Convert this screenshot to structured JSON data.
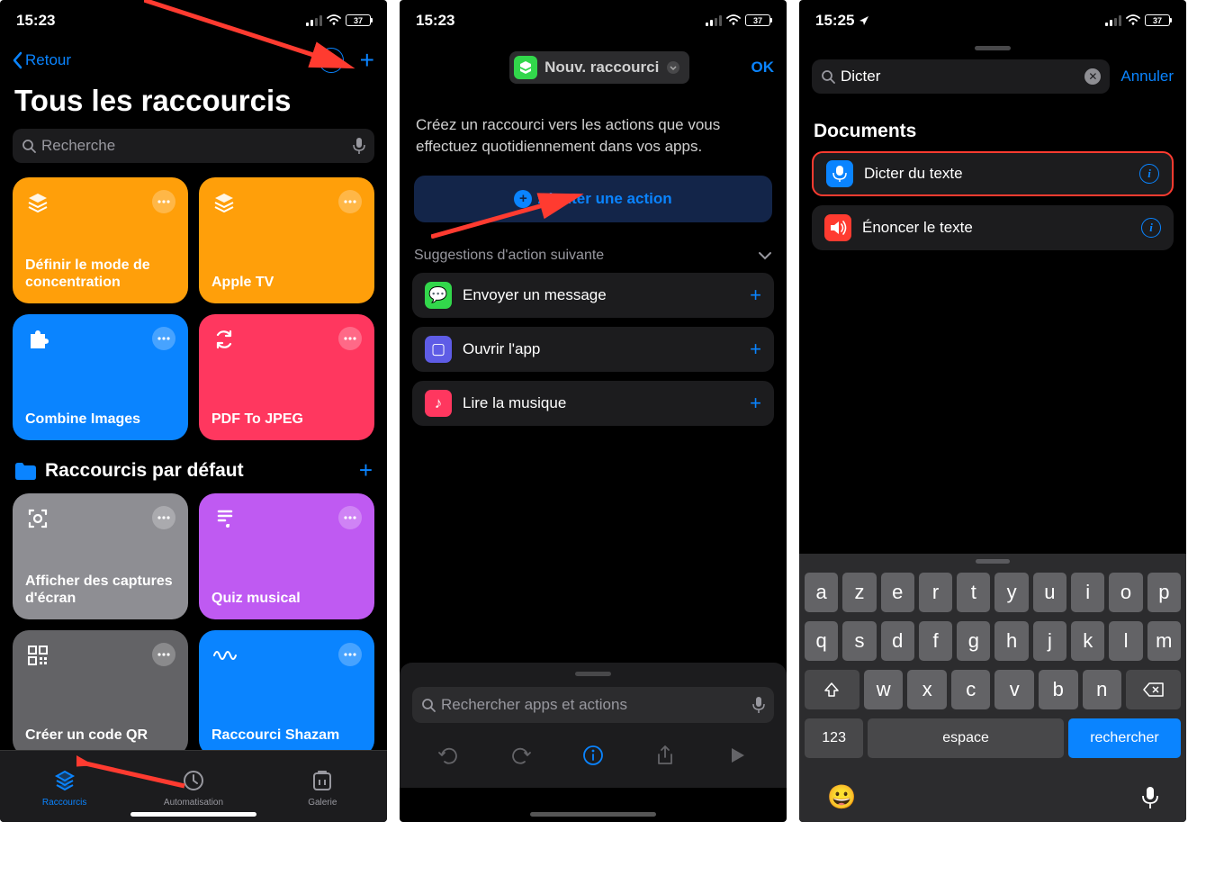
{
  "screen1": {
    "time": "15:23",
    "battery": "37",
    "back": "Retour",
    "title": "Tous les raccourcis",
    "search_placeholder": "Recherche",
    "tiles": [
      {
        "label": "Définir le mode de concentration",
        "color": "#ff9f0a",
        "icon": "layers"
      },
      {
        "label": "Apple TV",
        "color": "#ff9f0a",
        "icon": "layers"
      },
      {
        "label": "Combine Images",
        "color": "#0a84ff",
        "icon": "puzzle"
      },
      {
        "label": "PDF To JPEG",
        "color": "#ff375f",
        "icon": "sync"
      }
    ],
    "section": "Raccourcis par défaut",
    "tiles2": [
      {
        "label": "Afficher des captures d'écran",
        "color": "#8e8e93",
        "icon": "scan"
      },
      {
        "label": "Quiz musical",
        "color": "#bf5af2",
        "icon": "note"
      },
      {
        "label": "Créer un code QR",
        "color": "#636366",
        "icon": "qr"
      },
      {
        "label": "Raccourci Shazam",
        "color": "#0a84ff",
        "icon": "wave"
      }
    ],
    "tabs": [
      {
        "label": "Raccourcis",
        "active": true
      },
      {
        "label": "Automatisation",
        "active": false
      },
      {
        "label": "Galerie",
        "active": false
      }
    ]
  },
  "screen2": {
    "time": "15:23",
    "battery": "37",
    "title": "Nouv. raccourci",
    "ok": "OK",
    "desc": "Créez un raccourci vers les actions que vous effectuez quotidiennement dans vos apps.",
    "add_action": "Ajouter une action",
    "suggestions_title": "Suggestions d'action suivante",
    "suggestions": [
      {
        "label": "Envoyer un message",
        "color": "#32d74b",
        "glyph": "💬"
      },
      {
        "label": "Ouvrir l'app",
        "color": "#5e5ce6",
        "glyph": "▢"
      },
      {
        "label": "Lire la musique",
        "color": "#ff375f",
        "glyph": "♪"
      }
    ],
    "search_placeholder": "Rechercher apps et actions"
  },
  "screen3": {
    "time": "15:25",
    "battery": "37",
    "search_value": "Dicter",
    "cancel": "Annuler",
    "section": "Documents",
    "results": [
      {
        "label": "Dicter du texte",
        "color": "#0a84ff",
        "highlight": true
      },
      {
        "label": "Énoncer le texte",
        "color": "#ff3b30",
        "highlight": false
      }
    ],
    "keyboard": {
      "row1": [
        "a",
        "z",
        "e",
        "r",
        "t",
        "y",
        "u",
        "i",
        "o",
        "p"
      ],
      "row2": [
        "q",
        "s",
        "d",
        "f",
        "g",
        "h",
        "j",
        "k",
        "l",
        "m"
      ],
      "row3": [
        "w",
        "x",
        "c",
        "v",
        "b",
        "n"
      ],
      "num": "123",
      "space": "espace",
      "search": "rechercher"
    }
  }
}
